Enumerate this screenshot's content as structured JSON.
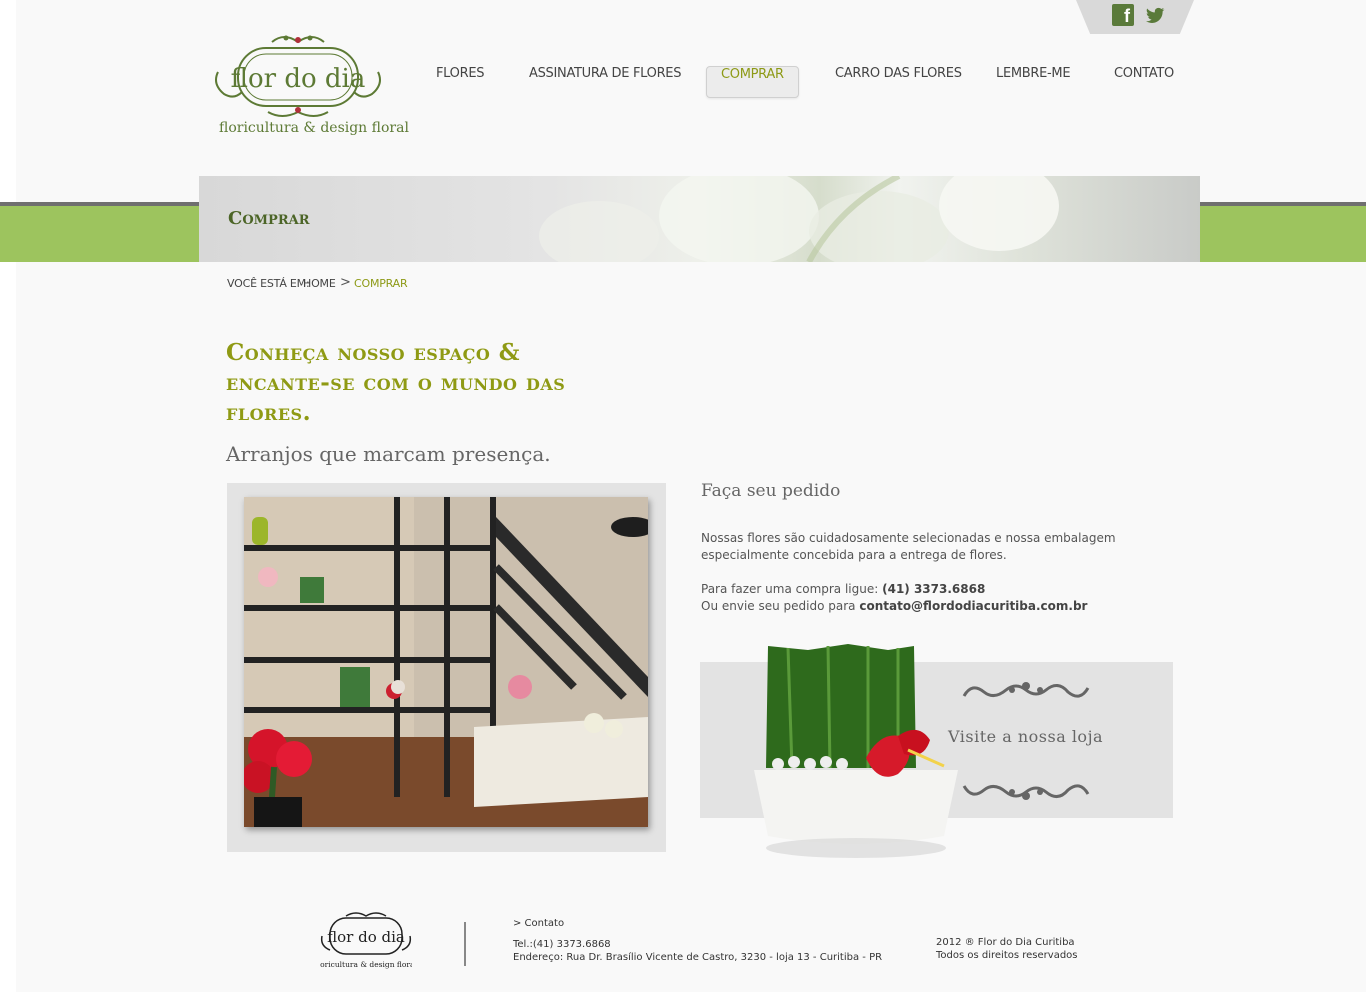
{
  "brand": {
    "name_logo": "flor do dia",
    "tagline": "floricultura & design floral"
  },
  "social": {
    "facebook": "f",
    "icons": [
      "facebook-icon",
      "twitter-icon"
    ]
  },
  "nav": {
    "items": [
      {
        "label": "FLORES"
      },
      {
        "label": "ASSINATURA DE FLORES"
      },
      {
        "label": "COMPRAR"
      },
      {
        "label": "CARRO DAS FLORES"
      },
      {
        "label": "LEMBRE-ME"
      },
      {
        "label": "CONTATO"
      }
    ],
    "active_index": 2
  },
  "banner": {
    "title": "Comprar"
  },
  "breadcrumb": {
    "prefix": "VOCÊ ESTÁ EM:",
    "home": "HOME",
    "separator": ">",
    "current": "COMPRAR"
  },
  "main": {
    "headline": "Conheça nosso espaço & encante-se com o mundo das flores.",
    "subhead": "Arranjos que marcam presença."
  },
  "order": {
    "title": "Faça seu pedido",
    "line1": "Nossas flores são cuidadosamente selecionadas e nossa embalagem",
    "line2": "especialmente concebida para a entrega de flores.",
    "phone_prefix": "Para fazer uma compra ligue: ",
    "phone": "(41) 3373.6868",
    "email_prefix": "Ou envie seu pedido para ",
    "email": "contato@flordodiacuritiba.com.br"
  },
  "shop": {
    "label": "Visite a nossa loja"
  },
  "footer": {
    "contact_link": "> Contato",
    "tel": "Tel.:(41) 3373.6868",
    "address": "Endereço: Rua Dr. Brasílio Vicente de Castro, 3230 - loja 13 - Curitiba - PR",
    "copyright": "2012 ® Flor do Dia Curitiba",
    "rights": "Todos os direitos reservados"
  },
  "colors": {
    "accent_green": "#9dc45e",
    "brand_green": "#5d7a35",
    "olive": "#8f9a14",
    "background": "#f9f9f9"
  }
}
